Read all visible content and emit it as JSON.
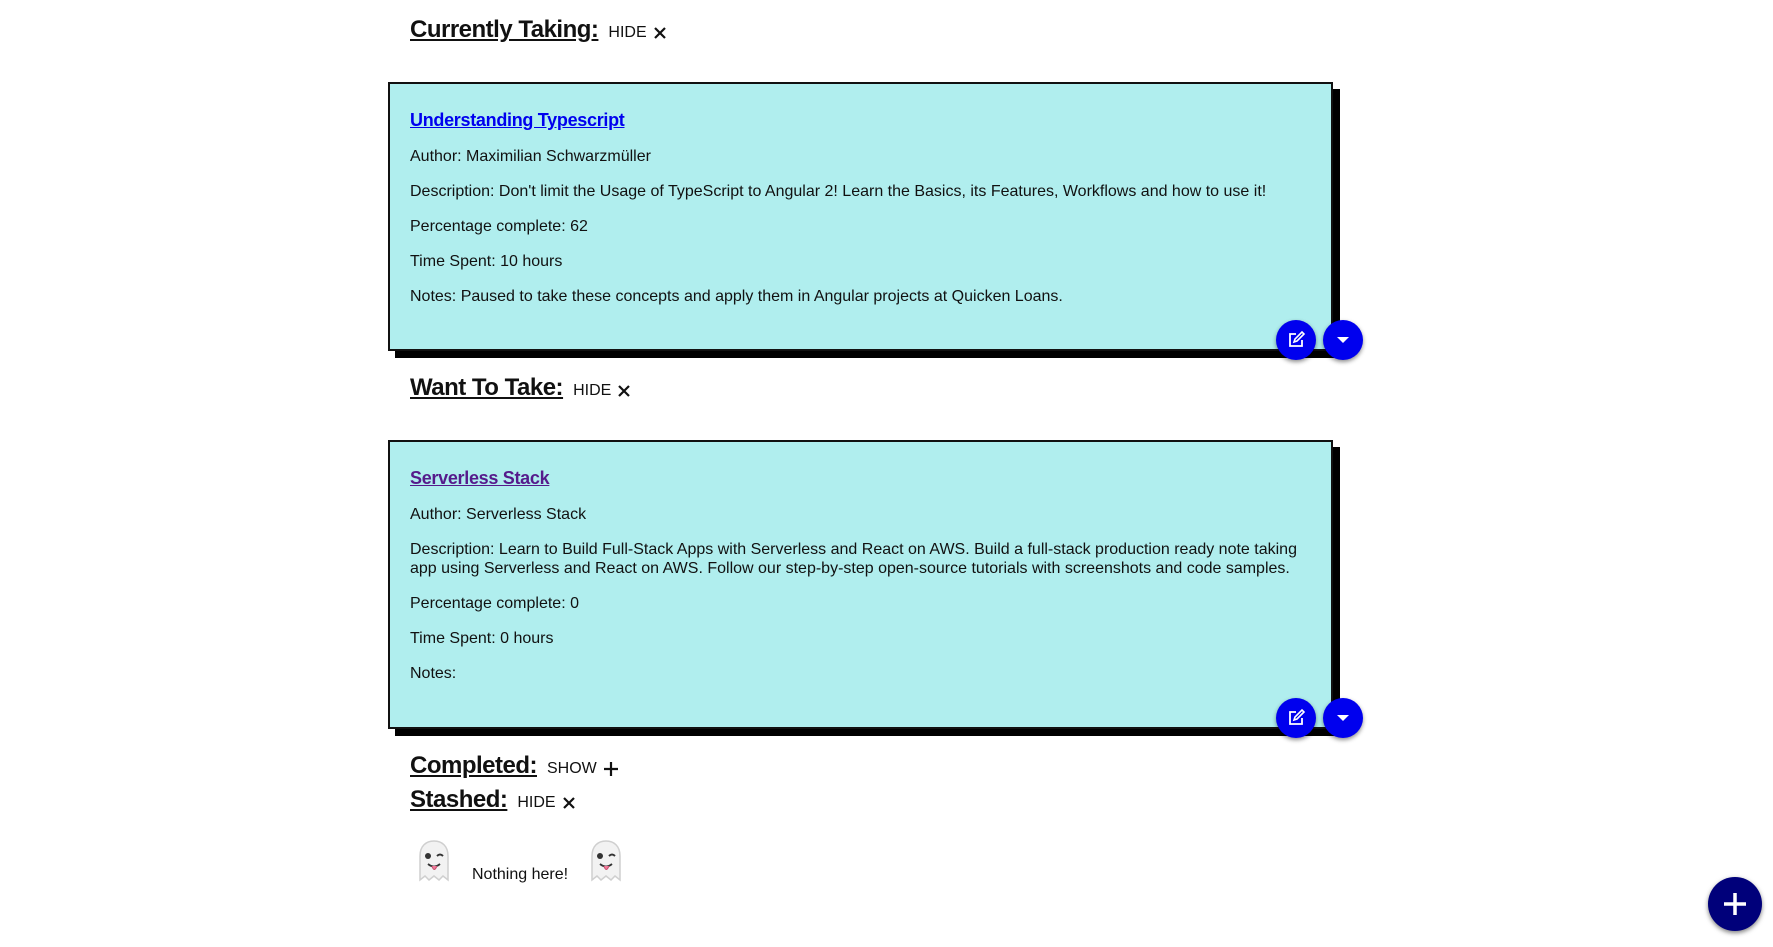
{
  "sections": {
    "currently_taking": {
      "title": "Currently Taking:",
      "toggle": "HIDE"
    },
    "want_to_take": {
      "title": "Want To Take:",
      "toggle": "HIDE"
    },
    "completed": {
      "title": "Completed:",
      "toggle": "SHOW"
    },
    "stashed": {
      "title": "Stashed:",
      "toggle": "HIDE"
    }
  },
  "courses": [
    {
      "title": "Understanding Typescript",
      "author": "Author: Maximilian Schwarzmüller",
      "description": "Description: Don't limit the Usage of TypeScript to Angular 2! Learn the Basics, its Features, Workflows and how to use it!",
      "percentage": "Percentage complete: 62",
      "time_spent": "Time Spent: 10 hours",
      "notes": "Notes: Paused to take these concepts and apply them in Angular projects at Quicken Loans."
    },
    {
      "title": "Serverless Stack",
      "author": "Author: Serverless Stack",
      "description": "Description: Learn to Build Full-Stack Apps with Serverless and React on AWS. Build a full-stack production ready note taking app using Serverless and React on AWS. Follow our step-by-step open-source tutorials with screenshots and code samples.",
      "percentage": "Percentage complete: 0",
      "time_spent": "Time Spent: 0 hours",
      "notes": "Notes:"
    }
  ],
  "empty_state": {
    "text": "Nothing here!",
    "icon": "ghost-icon"
  },
  "colors": {
    "card_bg": "#b0eeee",
    "button_blue": "#0000ee",
    "add_button": "#00007a",
    "link": "#0000ee",
    "visited_link": "#551a8b"
  }
}
